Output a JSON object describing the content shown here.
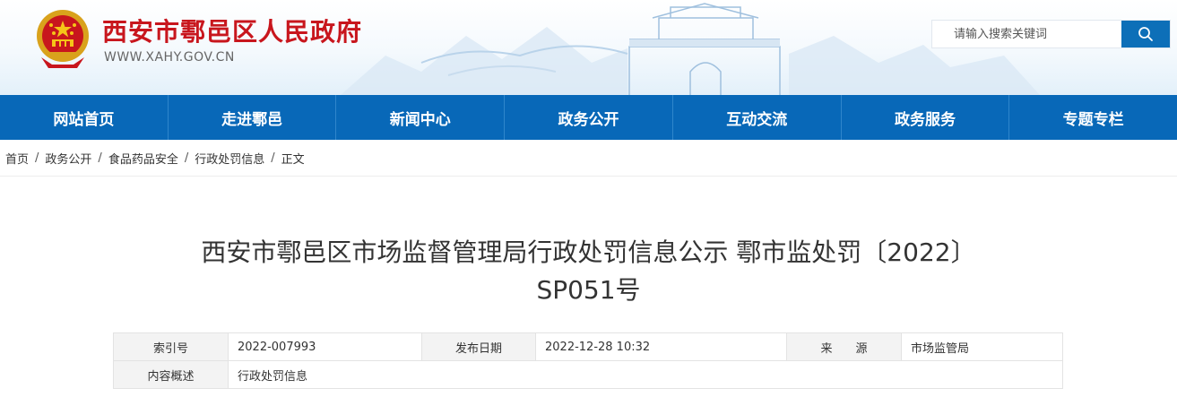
{
  "header": {
    "site_title": "西安市鄠邑区人民政府",
    "site_domain": "WWW.XAHY.GOV.CN",
    "search": {
      "placeholder": "请输入搜索关键词"
    }
  },
  "nav": {
    "items": [
      "网站首页",
      "走进鄠邑",
      "新闻中心",
      "政务公开",
      "互动交流",
      "政务服务",
      "专题专栏"
    ]
  },
  "breadcrumb": {
    "items": [
      "首页",
      "政务公开",
      "食品药品安全",
      "行政处罚信息",
      "正文"
    ],
    "separator": "/"
  },
  "article": {
    "title_line1": "西安市鄠邑区市场监督管理局行政处罚信息公示 鄠市监处罚〔2022〕",
    "title_line2": "SP051号"
  },
  "meta": {
    "index_label": "索引号",
    "index_value": "2022-007993",
    "date_label": "发布日期",
    "date_value": "2022-12-28 10:32",
    "source_label": "来　　源",
    "source_value": "市场监管局",
    "summary_label": "内容概述",
    "summary_value": "行政处罚信息"
  },
  "colors": {
    "brand_red": "#c8161d",
    "nav_blue": "#0868b8",
    "search_blue": "#0d6fb8"
  }
}
